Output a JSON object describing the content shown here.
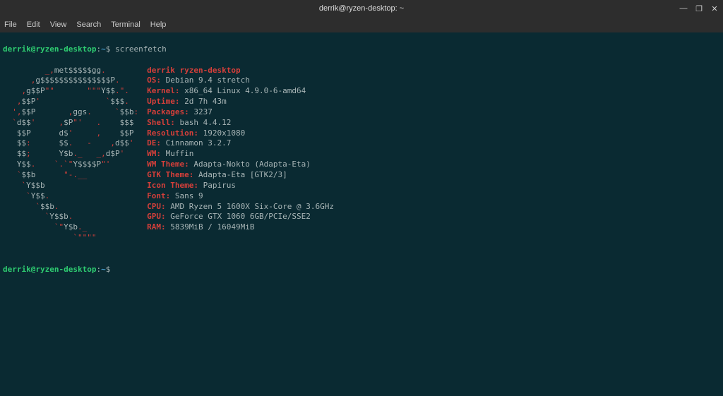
{
  "window": {
    "title": "derrik@ryzen-desktop: ~",
    "controls": {
      "minimize": "—",
      "maximize": "❐",
      "close": "✕"
    }
  },
  "menubar": [
    "File",
    "Edit",
    "View",
    "Search",
    "Terminal",
    "Help"
  ],
  "prompt": {
    "userhost": "derrik@ryzen-desktop",
    "sep": ":",
    "path": "~",
    "sigil": "$"
  },
  "command": "screenfetch",
  "ascii_art": [
    "         _,met$$$$$gg.",
    "      ,g$$$$$$$$$$$$$$$P.",
    "    ,g$$P\"\"       \"\"\"Y$$.\".",
    "   ,$$P'              `$$$.",
    "  ',$$P       ,ggs.     `$$b:",
    "  `d$$'     ,$P\"'   .    $$$",
    "   $$P      d$'     ,    $$P",
    "   $$:      $$.   -    ,d$$'",
    "   $$;      Y$b._   _,d$P'",
    "   Y$$.    `.`\"Y$$$$P\"'",
    "   `$$b      \"-.__",
    "    `Y$$b",
    "     `Y$$.",
    "       `$$b.",
    "         `Y$$b.",
    "           `\"Y$b._",
    "               `\"\"\"\""
  ],
  "info": {
    "header": "derrik ryzen-desktop",
    "items": [
      {
        "key": "OS:",
        "val": " Debian 9.4 stretch"
      },
      {
        "key": "Kernel:",
        "val": " x86_64 Linux 4.9.0-6-amd64"
      },
      {
        "key": "Uptime:",
        "val": " 2d 7h 43m"
      },
      {
        "key": "Packages:",
        "val": " 3237"
      },
      {
        "key": "Shell:",
        "val": " bash 4.4.12"
      },
      {
        "key": "Resolution:",
        "val": " 1920x1080"
      },
      {
        "key": "DE:",
        "val": " Cinnamon 3.2.7"
      },
      {
        "key": "WM:",
        "val": " Muffin"
      },
      {
        "key": "WM Theme:",
        "val": " Adapta-Nokto (Adapta-Eta)"
      },
      {
        "key": "GTK Theme:",
        "val": " Adapta-Eta [GTK2/3]"
      },
      {
        "key": "Icon Theme:",
        "val": " Papirus"
      },
      {
        "key": "Font:",
        "val": " Sans 9"
      },
      {
        "key": "CPU:",
        "val": " AMD Ryzen 5 1600X Six-Core @ 3.6GHz"
      },
      {
        "key": "GPU:",
        "val": " GeForce GTX 1060 6GB/PCIe/SSE2"
      },
      {
        "key": "RAM:",
        "val": " 5839MiB / 16049MiB"
      }
    ]
  }
}
